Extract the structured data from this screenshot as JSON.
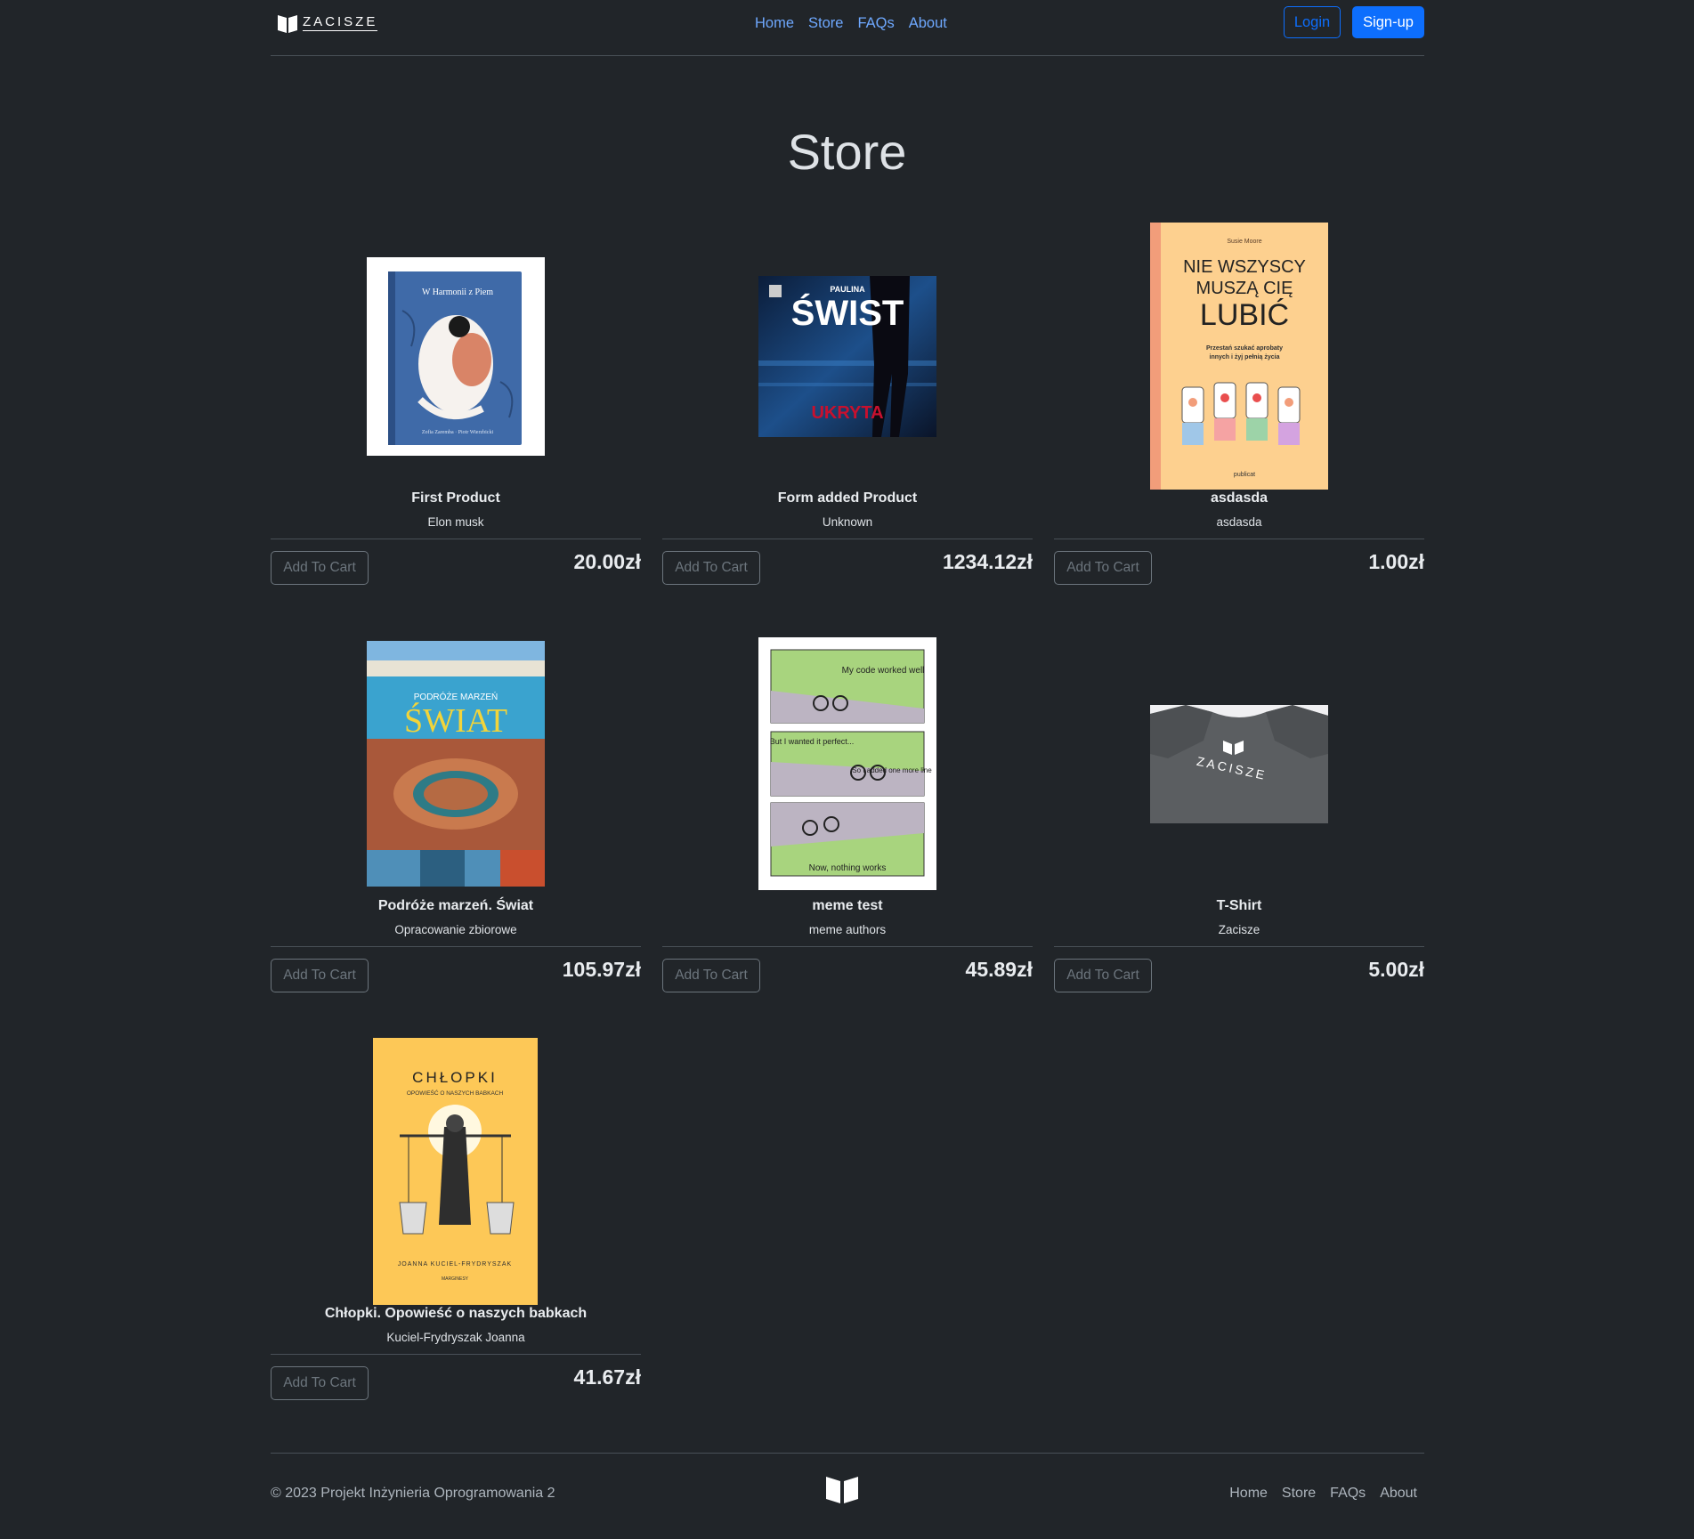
{
  "header": {
    "brand": "ZACISZE",
    "nav": [
      "Home",
      "Store",
      "FAQs",
      "About"
    ],
    "login": "Login",
    "signup": "Sign-up"
  },
  "page_title": "Store",
  "products": [
    {
      "name": "First Product",
      "author": "Elon musk",
      "price": "20.00zł",
      "cart": "Add To Cart",
      "image": "book cover: W Harmonii z Piem"
    },
    {
      "name": "Form added Product",
      "author": "Unknown",
      "price": "1234.12zł",
      "cart": "Add To Cart",
      "image": "book cover: Paulina Świst Ukryta"
    },
    {
      "name": "asdasda",
      "author": "asdasda",
      "price": "1.00zł",
      "cart": "Add To Cart",
      "image": "book cover: Nie wszyscy muszą cię lubić"
    },
    {
      "name": "Podróże marzeń. Świat",
      "author": "Opracowanie zbiorowe",
      "price": "105.97zł",
      "cart": "Add To Cart",
      "image": "book cover: Podróże marzeń Świat"
    },
    {
      "name": "meme test",
      "author": "meme authors",
      "price": "45.89zł",
      "cart": "Add To Cart",
      "image": "bike meme"
    },
    {
      "name": "T-Shirt",
      "author": "Zacisze",
      "price": "5.00zł",
      "cart": "Add To Cart",
      "image": "grey t-shirt with Zacisze logo"
    },
    {
      "name": "Chłopki. Opowieść o naszych babkach",
      "author": "Kuciel-Frydryszak Joanna",
      "price": "41.67zł",
      "cart": "Add To Cart",
      "image": "book cover: Chłopki"
    }
  ],
  "covers": {
    "harmonii": {
      "title": "W Harmonii z Piem",
      "authors": "Zofia Zaremba · Piotr Wierzbicki"
    },
    "swist": {
      "top": "PAULINA",
      "title": "ŚWIST",
      "sub": "UKRYTA"
    },
    "lubic": {
      "author": "Susie Moore",
      "line1": "NIE WSZYSCY",
      "line2": "MUSZĄ CIĘ",
      "line3": "LUBIĆ",
      "tagline1": "Przestań szukać aprobaty",
      "tagline2": "innych i żyj pełnią życia",
      "publisher": "publicat"
    },
    "swiat": {
      "top": "PODRÓŻE MARZEŃ",
      "title": "ŚWIAT"
    },
    "meme": {
      "p1": "My code worked well",
      "p2": "But I wanted it perfect...",
      "p3": "So I added one more line",
      "p4": "Now, nothing works"
    },
    "tshirt": {
      "text": "ZACISZE"
    },
    "chlopki": {
      "title": "CHŁOPKI",
      "sub": "OPOWIEŚĆ O NASZYCH BABKACH",
      "author": "JOANNA KUCIEL-FRYDRYSZAK",
      "publisher": "MARGINESY"
    }
  },
  "footer": {
    "copyright": "© 2023 Projekt Inżynieria Oprogramowania 2",
    "nav": [
      "Home",
      "Store",
      "FAQs",
      "About"
    ]
  },
  "colors": {
    "background": "#212529",
    "accent": "#0d6efd",
    "link": "#6ea8fe"
  }
}
